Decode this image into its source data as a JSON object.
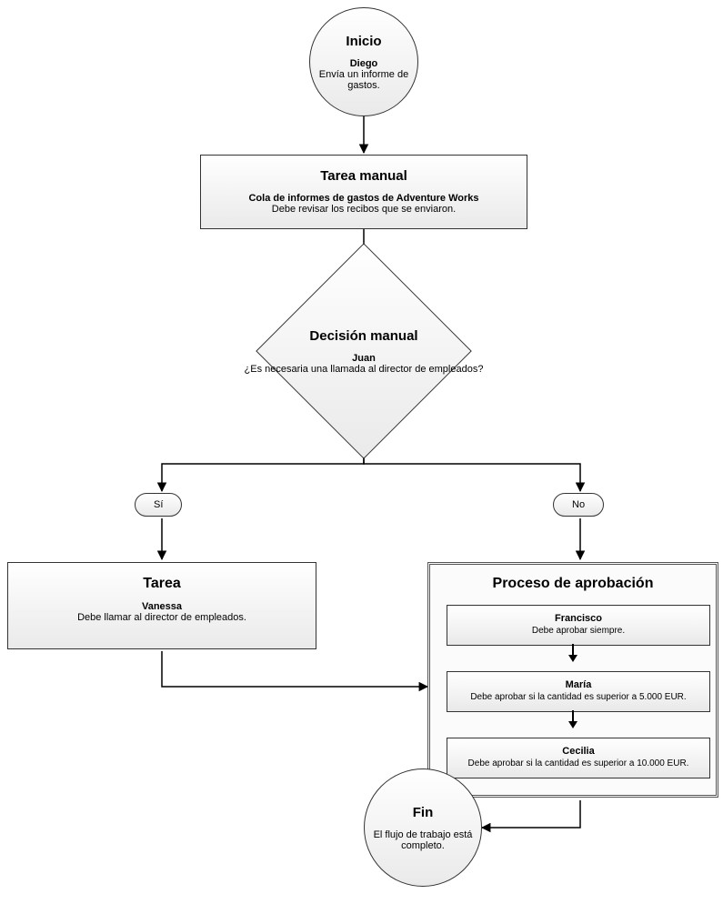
{
  "start": {
    "title": "Inicio",
    "actor": "Diego",
    "action": "Envía un informe de gastos."
  },
  "manual_task": {
    "title": "Tarea manual",
    "actor": "Cola de informes de gastos de Adventure Works",
    "action": "Debe revisar los recibos que se enviaron."
  },
  "decision": {
    "title": "Decisión manual",
    "actor": "Juan",
    "question": "¿Es necesaria una llamada al director de empleados?"
  },
  "branches": {
    "yes_label": "Sí",
    "no_label": "No"
  },
  "task": {
    "title": "Tarea",
    "actor": "Vanessa",
    "action": "Debe llamar al director de empleados."
  },
  "approval": {
    "title": "Proceso de aprobación",
    "steps": [
      {
        "name": "Francisco",
        "desc": "Debe aprobar siempre."
      },
      {
        "name": "María",
        "desc": "Debe aprobar si la cantidad es superior a 5.000 EUR."
      },
      {
        "name": "Cecilia",
        "desc": "Debe aprobar si la cantidad es superior a 10.000 EUR."
      }
    ]
  },
  "end": {
    "title": "Fin",
    "text_line1": "El flujo de trabajo está",
    "text_line2": "completo."
  }
}
